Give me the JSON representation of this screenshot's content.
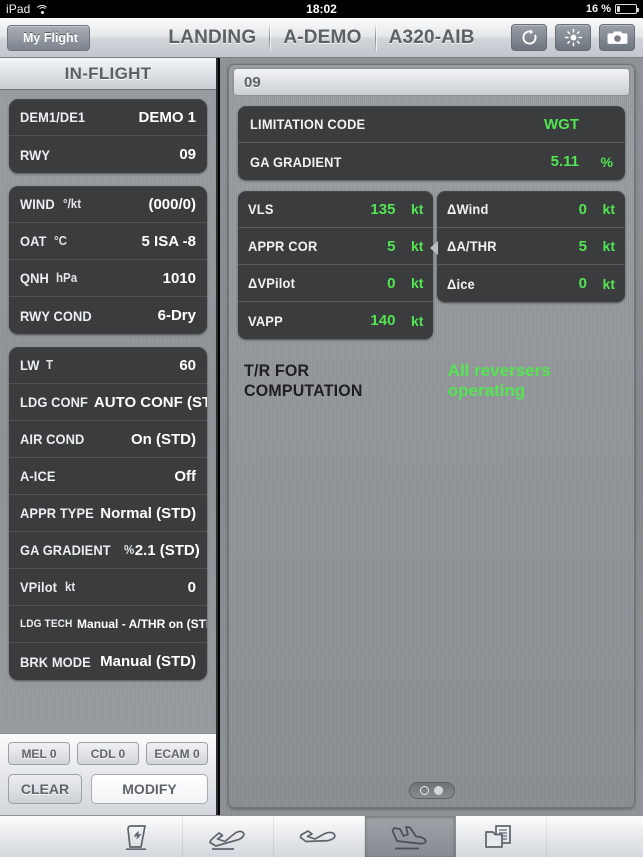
{
  "status_bar": {
    "device": "iPad",
    "wifi_icon": "wifi-icon",
    "time": "18:02",
    "battery_percent": "16 %",
    "battery_icon": "battery-icon"
  },
  "navbar": {
    "back_label": "My Flight",
    "titles": [
      "LANDING",
      "A-DEMO",
      "A320-AIB"
    ],
    "actions": [
      {
        "name": "refresh-icon",
        "label": "refresh"
      },
      {
        "name": "brightness-icon",
        "label": "brightness"
      },
      {
        "name": "camera-icon",
        "label": "camera"
      }
    ]
  },
  "sidebar": {
    "header": "IN-FLIGHT",
    "groups": [
      {
        "rows": [
          {
            "label": "DEM1/DE1",
            "unit": "",
            "value": "DEMO 1"
          },
          {
            "label": "RWY",
            "unit": "",
            "value": "09"
          }
        ]
      },
      {
        "rows": [
          {
            "label": "WIND",
            "unit": "°/kt",
            "value": "(000/0)"
          },
          {
            "label": "OAT",
            "unit": "°C",
            "value": "5 ISA -8"
          },
          {
            "label": "QNH",
            "unit": "hPa",
            "value": "1010"
          },
          {
            "label": "RWY COND",
            "unit": "",
            "value": "6-Dry"
          }
        ]
      },
      {
        "rows": [
          {
            "label": "LW",
            "unit": "T",
            "value": "60"
          },
          {
            "label": "LDG CONF",
            "unit": "",
            "value": "AUTO CONF (STD)"
          },
          {
            "label": "AIR COND",
            "unit": "",
            "value": "On (STD)"
          },
          {
            "label": "A-ICE",
            "unit": "",
            "value": "Off"
          },
          {
            "label": "APPR TYPE",
            "unit": "",
            "value": "Normal (STD)"
          },
          {
            "label": "GA GRADIENT",
            "unit": "%",
            "value": "2.1 (STD)"
          },
          {
            "label": "VPilot",
            "unit": "kt",
            "value": "0"
          },
          {
            "label": "LDG TECH",
            "unit": "",
            "value": "Manual - A/THR on (STD)",
            "small": true
          },
          {
            "label": "BRK MODE",
            "unit": "",
            "value": "Manual (STD)"
          }
        ]
      }
    ],
    "chips": [
      "MEL 0",
      "CDL 0",
      "ECAM 0"
    ],
    "clear_label": "CLEAR",
    "modify_label": "MODIFY"
  },
  "main": {
    "card_title": "09",
    "limitation_group": [
      {
        "label": "LIMITATION CODE",
        "value": "WGT",
        "unit": ""
      },
      {
        "label": "GA GRADIENT",
        "value": "5.11",
        "unit": "%"
      }
    ],
    "speeds_left": [
      {
        "label": "VLS",
        "value": "135",
        "unit": "kt"
      },
      {
        "label": "APPR COR",
        "value": "5",
        "unit": "kt"
      },
      {
        "label": "ΔVPilot",
        "value": "0",
        "unit": "kt"
      },
      {
        "label": "VAPP",
        "value": "140",
        "unit": "kt"
      }
    ],
    "speeds_right": [
      {
        "label": "ΔWind",
        "value": "0",
        "unit": "kt"
      },
      {
        "label": "ΔA/THR",
        "value": "5",
        "unit": "kt"
      },
      {
        "label": "Δice",
        "value": "0",
        "unit": "kt"
      }
    ],
    "tr_label": "T/R FOR COMPUTATION",
    "tr_value": "All reversers operating",
    "page_dots": 2,
    "page_active_index": 1
  },
  "tabbar": {
    "tabs": [
      {
        "name": "tab-aircraft-tail",
        "icon": "tail-fin-icon",
        "active": false
      },
      {
        "name": "tab-takeoff",
        "icon": "takeoff-icon",
        "active": false
      },
      {
        "name": "tab-cruise",
        "icon": "cruise-icon",
        "active": false
      },
      {
        "name": "tab-landing",
        "icon": "landing-icon",
        "active": true
      },
      {
        "name": "tab-documents",
        "icon": "documents-icon",
        "active": false
      }
    ]
  },
  "colors": {
    "green": "#53e552",
    "panel_dark": "#3a3c3e",
    "brushed": "#8d9195"
  }
}
